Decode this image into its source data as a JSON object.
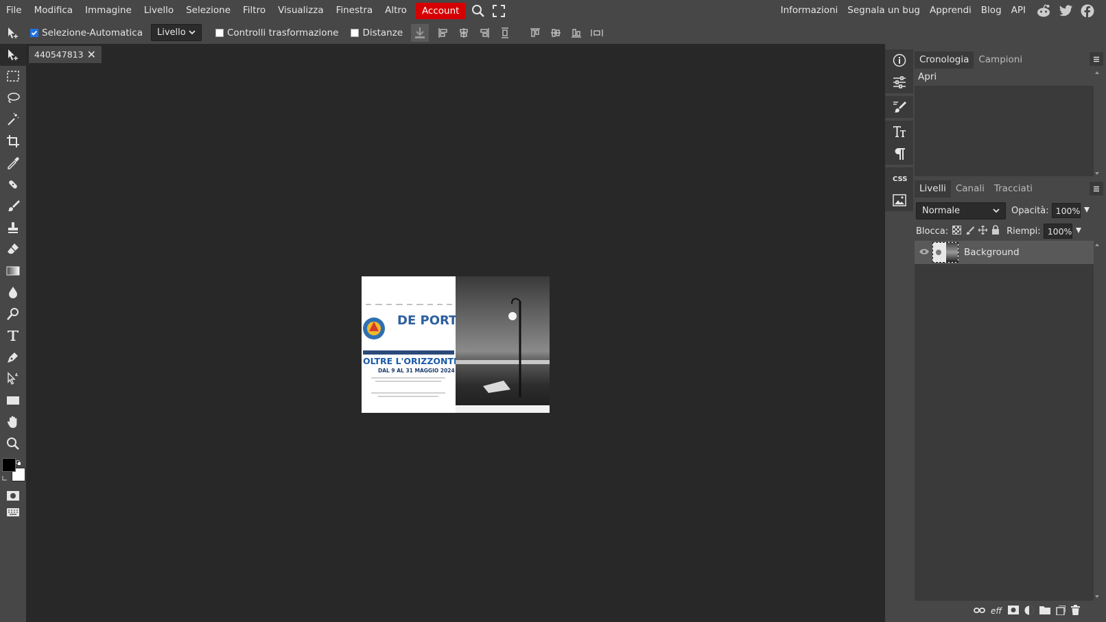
{
  "menubar": {
    "items": [
      "File",
      "Modifica",
      "Immagine",
      "Livello",
      "Selezione",
      "Filtro",
      "Visualizza",
      "Finestra",
      "Altro"
    ],
    "account_label": "Account",
    "right_items": [
      "Informazioni",
      "Segnala un bug",
      "Apprendi",
      "Blog",
      "API"
    ],
    "icons": [
      "search-icon",
      "fullscreen-icon"
    ],
    "social_icons": [
      "reddit-icon",
      "twitter-icon",
      "facebook-icon"
    ]
  },
  "options": {
    "auto_select_label": "Selezione-Automatica",
    "auto_select_checked": true,
    "target_select": "Livello",
    "transform_controls_label": "Controlli trasformazione",
    "distances_label": "Distanze"
  },
  "toolbar": {
    "tools": [
      "move-tool-icon",
      "marquee-tool-icon",
      "lasso-tool-icon",
      "magic-wand-tool-icon",
      "crop-tool-icon",
      "eyedropper-tool-icon",
      "healing-tool-icon",
      "brush-tool-icon",
      "clone-stamp-tool-icon",
      "eraser-tool-icon",
      "gradient-tool-icon",
      "blur-tool-icon",
      "dodge-tool-icon",
      "text-tool-icon",
      "pen-tool-icon",
      "path-select-tool-icon",
      "shape-tool-icon",
      "hand-tool-icon",
      "zoom-tool-icon"
    ],
    "foreground_color": "#000000",
    "background_color": "#ffffff"
  },
  "document": {
    "tab_name": "440547813",
    "poster_text": {
      "brand": "DE PORTI BUS",
      "headline": "OLTRE L'ORIZZONTE",
      "dates": "DAL 9 AL 31 MAGGIO 2024"
    }
  },
  "history": {
    "tabs": [
      "Cronologia",
      "Campioni"
    ],
    "items": [
      "Apri"
    ]
  },
  "layers": {
    "tabs": [
      "Livelli",
      "Canali",
      "Tracciati"
    ],
    "blend_mode": "Normale",
    "opacity_label": "Opacità:",
    "opacity_value": "100%",
    "lock_label": "Blocca:",
    "fill_label": "Riempi:",
    "fill_value": "100%",
    "items": [
      {
        "name": "Background"
      }
    ],
    "footer_icons": [
      "link-icon",
      "effects-icon",
      "mask-icon",
      "adjustment-icon",
      "folder-icon",
      "new-layer-icon",
      "trash-icon"
    ]
  },
  "colors": {
    "account_red": "#d60000",
    "panel_bg": "#474747",
    "canvas_bg": "#282828",
    "accent_blue": "#1e72e8"
  }
}
